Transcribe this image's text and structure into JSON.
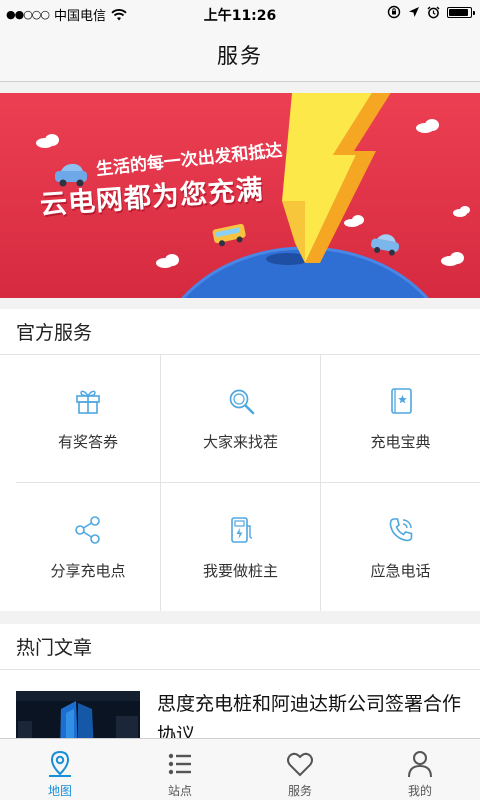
{
  "status_bar": {
    "signal_dots": "●●○○○",
    "carrier": "中国电信",
    "time": "上午11:26",
    "battery_level": 0.9
  },
  "nav": {
    "title": "服务"
  },
  "banner": {
    "line1": "生活的每一次出发和抵达",
    "line2": "云电网都为您充满"
  },
  "official_services": {
    "title": "官方服务",
    "items": [
      {
        "label": "有奖答券",
        "icon": "gift-icon"
      },
      {
        "label": "大家来找茬",
        "icon": "magnifier-icon"
      },
      {
        "label": "充电宝典",
        "icon": "book-icon"
      },
      {
        "label": "分享充电点",
        "icon": "share-icon"
      },
      {
        "label": "我要做桩主",
        "icon": "charging-pile-icon"
      },
      {
        "label": "应急电话",
        "icon": "phone-icon"
      }
    ]
  },
  "hot_articles": {
    "title": "热门文章",
    "items": [
      {
        "title": "思度充电桩和阿迪达斯公司签署合作协议"
      }
    ]
  },
  "tab_bar": {
    "active_color": "#1a8fd8",
    "tabs": [
      {
        "label": "地图",
        "icon": "map-pin-icon",
        "active": true
      },
      {
        "label": "站点",
        "icon": "list-icon",
        "active": false
      },
      {
        "label": "服务",
        "icon": "heart-icon",
        "active": false
      },
      {
        "label": "我的",
        "icon": "person-icon",
        "active": false
      }
    ]
  }
}
